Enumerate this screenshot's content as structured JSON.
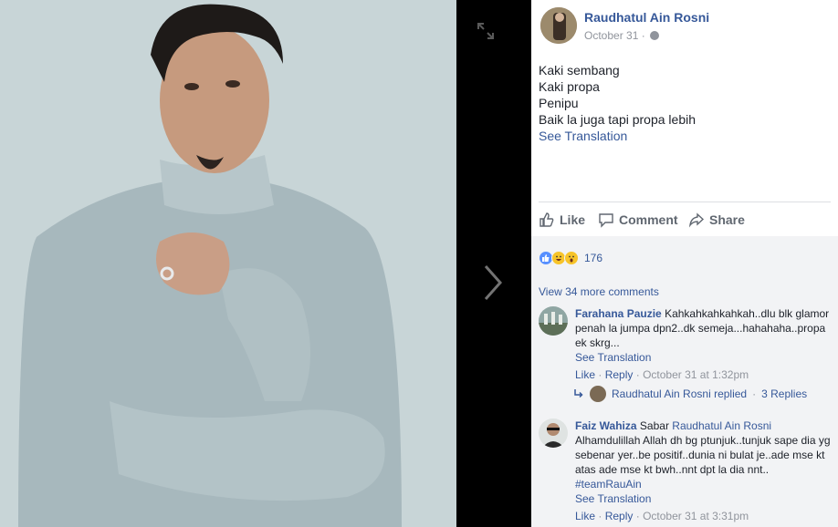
{
  "post": {
    "author": "Raudhatul Ain Rosni",
    "date": "October 31",
    "separator": "·",
    "lines": [
      "Kaki sembang",
      "Kaki propa",
      "Penipu",
      "Baik la juga tapi propa lebih"
    ],
    "see_translation": "See Translation"
  },
  "actions": {
    "like": "Like",
    "comment": "Comment",
    "share": "Share"
  },
  "reactions": {
    "count": "176",
    "types": [
      "like-icon",
      "haha-icon",
      "wow-icon"
    ]
  },
  "comments_section": {
    "view_more": "View 34 more comments",
    "comments": [
      {
        "author": "Farahana Pauzie",
        "text": "Kahkahkahkahkah..dlu blk glamor penah la jumpa dpn2..dk semeja...hahahaha..propa ek skrg...",
        "see_translation": "See Translation",
        "like": "Like",
        "reply": "Reply",
        "time": "October 31 at 1:32pm",
        "replies": {
          "who": "Raudhatul Ain Rosni replied",
          "sep": "·",
          "count": "3 Replies"
        }
      },
      {
        "author": "Faiz Wahiza",
        "mention_prefix": "Sabar",
        "mention": "Raudhatul Ain Rosni",
        "text": "Alhamdulillah Allah dh bg ptunjuk..tunjuk sape dia yg sebenar yer..be positif..dunia ni bulat je..ade mse kt atas ade mse kt bwh..nnt dpt la dia nnt..",
        "hashtag": "#teamRauAin",
        "see_translation": "See Translation",
        "like": "Like",
        "reply": "Reply",
        "time": "October 31 at 3:31pm"
      }
    ]
  },
  "colors": {
    "link": "#365899",
    "muted": "#90949c",
    "text": "#1d2129",
    "like_blue": "#5890ff",
    "reaction_yellow": "#f7c42a"
  }
}
